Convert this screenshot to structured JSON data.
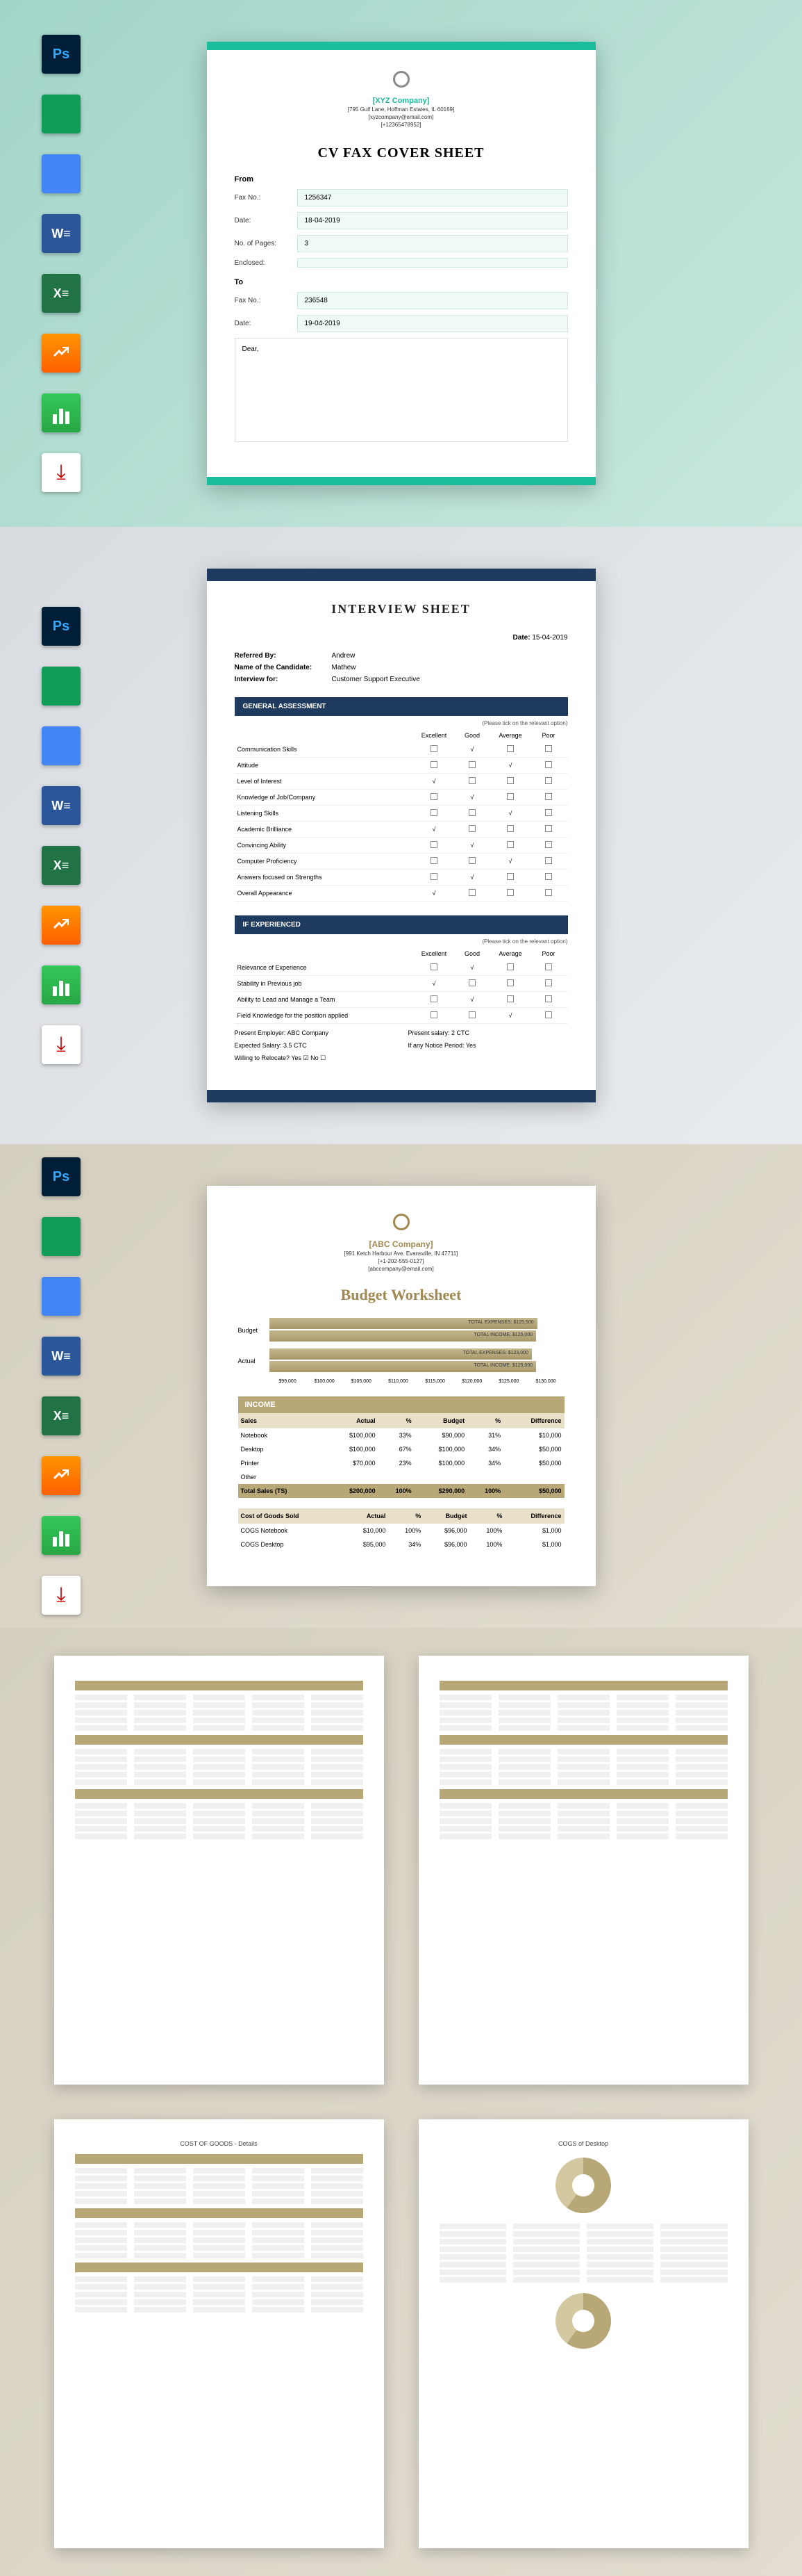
{
  "icons": [
    "ps",
    "sheets",
    "docs",
    "word",
    "excel",
    "pages",
    "numbers",
    "pdf"
  ],
  "doc1": {
    "company": "[XYZ Company]",
    "address": "[795 Gulf Lane, Hoffman Estates, IL 60169]",
    "email": "[xyzcompany@email.com]",
    "phone": "[+12365478952]",
    "title": "CV FAX COVER SHEET",
    "from_label": "From",
    "to_label": "To",
    "fields_from": [
      {
        "label": "Fax No.:",
        "value": "1256347"
      },
      {
        "label": "Date:",
        "value": "18-04-2019"
      },
      {
        "label": "No. of Pages:",
        "value": "3"
      },
      {
        "label": "Enclosed:",
        "value": ""
      }
    ],
    "fields_to": [
      {
        "label": "Fax No.:",
        "value": "236548"
      },
      {
        "label": "Date:",
        "value": "19-04-2019"
      }
    ],
    "dear": "Dear,"
  },
  "doc2": {
    "title": "INTERVIEW SHEET",
    "date_label": "Date:",
    "date": "15-04-2019",
    "info": [
      {
        "label": "Referred By:",
        "value": "Andrew"
      },
      {
        "label": "Name of the Candidate:",
        "value": "Mathew"
      },
      {
        "label": "Interview for:",
        "value": "Customer Support Executive"
      }
    ],
    "hdr1": "GENERAL ASSESSMENT",
    "hint": "(Please tick on the relevant option)",
    "cols": [
      "Excellent",
      "Good",
      "Average",
      "Poor"
    ],
    "rows1": [
      {
        "name": "Communication Skills",
        "tick": 1
      },
      {
        "name": "Attitude",
        "tick": 2
      },
      {
        "name": "Level of Interest",
        "tick": 0
      },
      {
        "name": "Knowledge of Job/Company",
        "tick": 1
      },
      {
        "name": "Listening Skills",
        "tick": 2
      },
      {
        "name": "Academic Brilliance",
        "tick": 0
      },
      {
        "name": "Convincing Ability",
        "tick": 1
      },
      {
        "name": "Computer Proficiency",
        "tick": 2
      },
      {
        "name": "Answers focused on Strengths",
        "tick": 1
      },
      {
        "name": "Overall Appearance",
        "tick": 0
      }
    ],
    "hdr2": "IF EXPERIENCED",
    "rows2": [
      {
        "name": "Relevance of Experience",
        "tick": 1
      },
      {
        "name": "Stability in Previous job",
        "tick": 0
      },
      {
        "name": "Ability to Lead and Manage a Team",
        "tick": 1
      },
      {
        "name": "Field Knowledge for the position applied",
        "tick": 2
      }
    ],
    "details": [
      {
        "l": "Present Employer:",
        "v": "ABC Company",
        "l2": "Present salary:",
        "v2": "2 CTC"
      },
      {
        "l": "Expected Salary:",
        "v": "3.5 CTC",
        "l2": "If any Notice Period:",
        "v2": "Yes"
      },
      {
        "l": "Willing to Relocate?",
        "v": "Yes ☑   No ☐",
        "l2": "",
        "v2": ""
      }
    ]
  },
  "doc3": {
    "company": "[ABC Company]",
    "address": "[991 Ketch Harbour Ave. Evansville, IN 47711]",
    "phone": "[+1-202-555-0127]",
    "email": "[abccompany@email.com]",
    "title": "Budget Worksheet",
    "chart_data": {
      "type": "bar",
      "orientation": "horizontal",
      "categories": [
        "Budget",
        "Actual"
      ],
      "series": [
        {
          "name": "TOTAL EXPENSES",
          "values": [
            125500,
            123000
          ]
        },
        {
          "name": "TOTAL INCOME",
          "values": [
            125000,
            125000
          ]
        }
      ],
      "xlim": [
        0,
        130000
      ],
      "xticks": [
        "$99,000",
        "$100,000",
        "$105,000",
        "$110,000",
        "$115,000",
        "$120,000",
        "$125,000",
        "$130,000"
      ]
    },
    "income_hdr": "INCOME",
    "cols": [
      "Actual",
      "%",
      "Budget",
      "%",
      "Difference"
    ],
    "sales": {
      "title": "Sales",
      "rows": [
        {
          "n": "Notebook",
          "v": [
            "$100,000",
            "33%",
            "$90,000",
            "31%",
            "$10,000"
          ]
        },
        {
          "n": "Desktop",
          "v": [
            "$100,000",
            "67%",
            "$100,000",
            "34%",
            "$50,000"
          ]
        },
        {
          "n": "Printer",
          "v": [
            "$70,000",
            "23%",
            "$100,000",
            "34%",
            "$50,000"
          ]
        },
        {
          "n": "Other",
          "v": [
            "",
            "",
            "",
            "",
            ""
          ]
        }
      ],
      "total": {
        "n": "Total Sales (TS)",
        "v": [
          "$200,000",
          "100%",
          "$290,000",
          "100%",
          "$50,000"
        ]
      }
    },
    "cogs": {
      "title": "Cost of Goods Sold",
      "rows": [
        {
          "n": "COGS Notebook",
          "v": [
            "$10,000",
            "100%",
            "$96,000",
            "100%",
            "$1,000"
          ]
        },
        {
          "n": "COGS Desktop",
          "v": [
            "$95,000",
            "34%",
            "$96,000",
            "100%",
            "$1,000"
          ]
        }
      ]
    }
  },
  "thumbs": [
    {
      "title": "",
      "type": "tables"
    },
    {
      "title": "",
      "type": "tables"
    },
    {
      "title": "COST OF GOODS - Details",
      "type": "tables"
    },
    {
      "title": "COGS of Desktop",
      "type": "pie"
    }
  ]
}
